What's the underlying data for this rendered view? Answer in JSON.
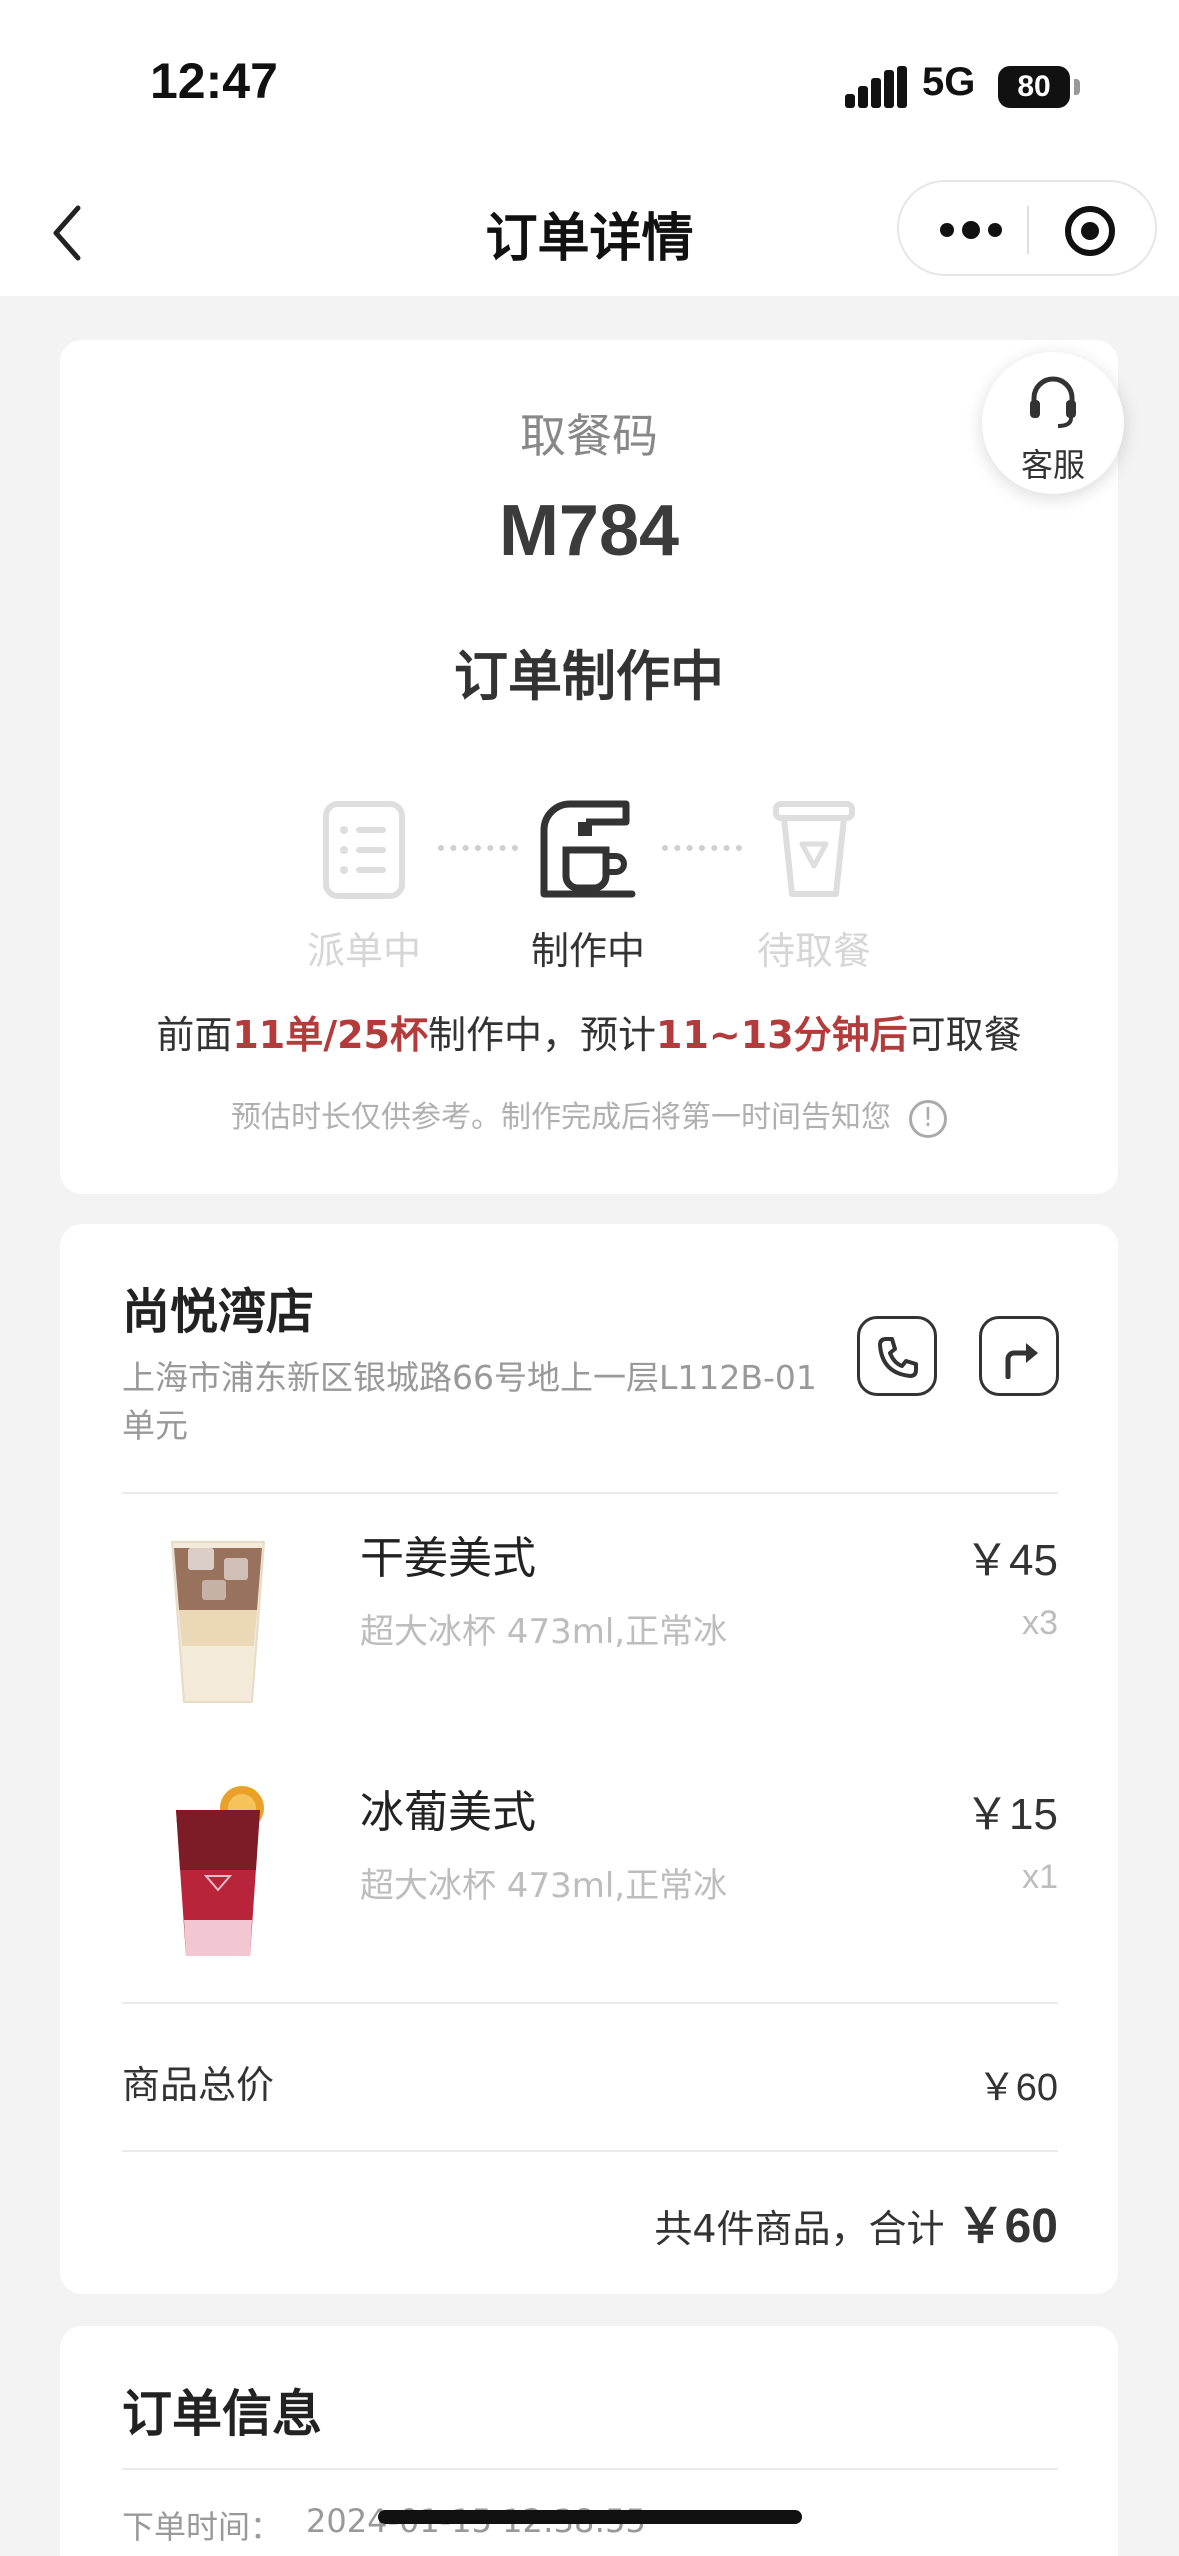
{
  "status_bar": {
    "time": "12:47",
    "network": "5G",
    "battery": "80"
  },
  "nav": {
    "title": "订单详情"
  },
  "service": {
    "label": "客服"
  },
  "pickup": {
    "label": "取餐码",
    "code": "M784",
    "status": "订单制作中",
    "steps": [
      {
        "label": "派单中",
        "active": false
      },
      {
        "label": "制作中",
        "active": true
      },
      {
        "label": "待取餐",
        "active": false
      }
    ],
    "queue": {
      "prefix": "前面",
      "orders": "11单/25杯",
      "mid": "制作中，预计",
      "eta": "11~13分钟后",
      "suffix": "可取餐"
    },
    "note": "预估时长仅供参考。制作完成后将第一时间告知您",
    "note_icon": "!"
  },
  "store": {
    "name": "尚悦湾店",
    "address": "上海市浦东新区银城路66号地上一层L112B-01单元"
  },
  "items": [
    {
      "name": "干姜美式",
      "spec": "超大冰杯 473ml,正常冰",
      "price": "￥45",
      "qty": "x3"
    },
    {
      "name": "冰葡美式",
      "spec": "超大冰杯 473ml,正常冰",
      "price": "￥15",
      "qty": "x1"
    }
  ],
  "summary": {
    "subtotal_label": "商品总价",
    "subtotal_value": "￥60",
    "total_prefix": "共4件商品，合计",
    "total_value": "￥60"
  },
  "order_info": {
    "title": "订单信息",
    "time_label": "下单时间：",
    "time_value": "2024-01-15 12:38:55"
  },
  "colors": {
    "highlight": "#b33b3b",
    "page_bg": "#f3f3f3"
  }
}
